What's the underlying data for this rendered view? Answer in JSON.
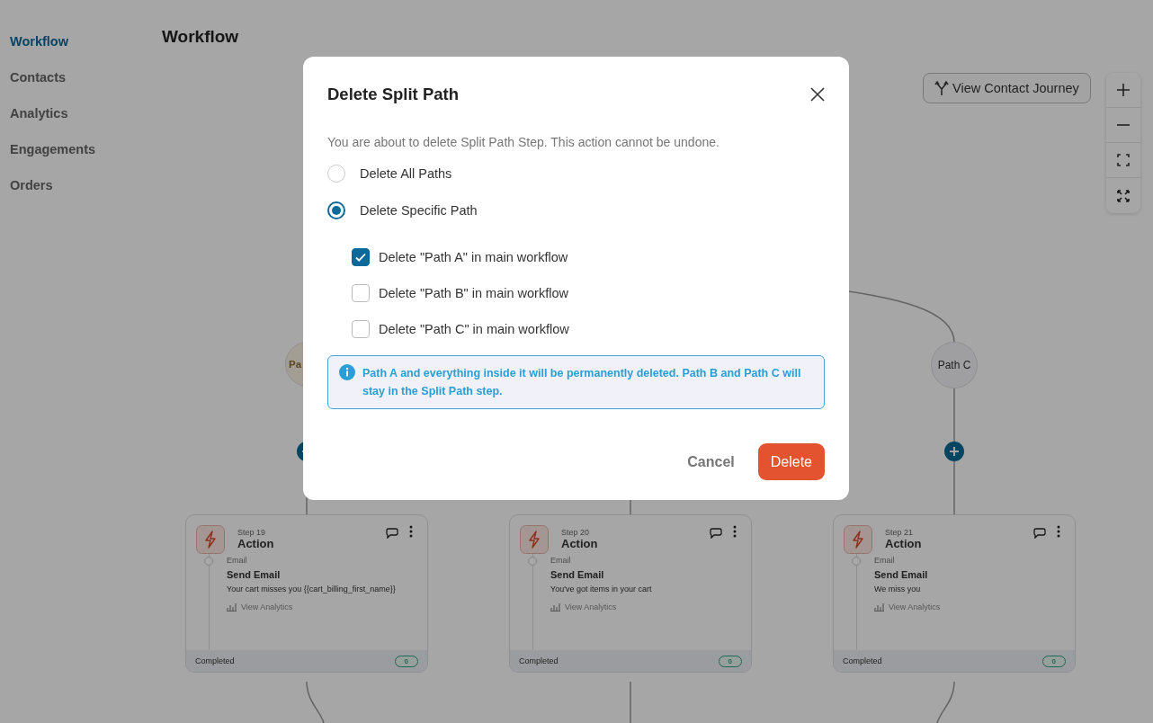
{
  "sidebar": {
    "items": [
      {
        "label": "Workflow",
        "selected": true
      },
      {
        "label": "Contacts",
        "selected": false
      },
      {
        "label": "Analytics",
        "selected": false
      },
      {
        "label": "Engagements",
        "selected": false
      },
      {
        "label": "Orders",
        "selected": false
      }
    ]
  },
  "page_title": "Workflow",
  "header_button": "View Contact Journey",
  "path_nodes": [
    {
      "label": "Pa"
    },
    {
      "label": "Path C"
    }
  ],
  "cards": [
    {
      "step": "Step 19",
      "type": "Action",
      "channel": "Email",
      "action": "Send Email",
      "subject": "Your cart misses you {{cart_billing_first_name}}",
      "analytics": "View Analytics",
      "status": "Completed",
      "count": "0"
    },
    {
      "step": "Step 20",
      "type": "Action",
      "channel": "Email",
      "action": "Send Email",
      "subject": "You've got items in your cart",
      "analytics": "View Analytics",
      "status": "Completed",
      "count": "0"
    },
    {
      "step": "Step 21",
      "type": "Action",
      "channel": "Email",
      "action": "Send Email",
      "subject": "We miss you",
      "analytics": "View Analytics",
      "status": "Completed",
      "count": "0"
    }
  ],
  "dialog": {
    "title": "Delete Split Path",
    "description": "You are about to delete Split Path Step. This action cannot be undone.",
    "options": [
      {
        "label": "Delete All Paths",
        "selected": false
      },
      {
        "label": "Delete Specific Path",
        "selected": true
      }
    ],
    "paths": [
      {
        "label": "Delete \"Path A\" in main workflow",
        "checked": true
      },
      {
        "label": "Delete \"Path B\" in main workflow",
        "checked": false
      },
      {
        "label": "Delete \"Path C\" in main workflow",
        "checked": false
      }
    ],
    "info": "Path A and everything inside it will be permanently deleted. Path B and Path C will stay in the Split Path step.",
    "cancel": "Cancel",
    "delete": "Delete"
  }
}
